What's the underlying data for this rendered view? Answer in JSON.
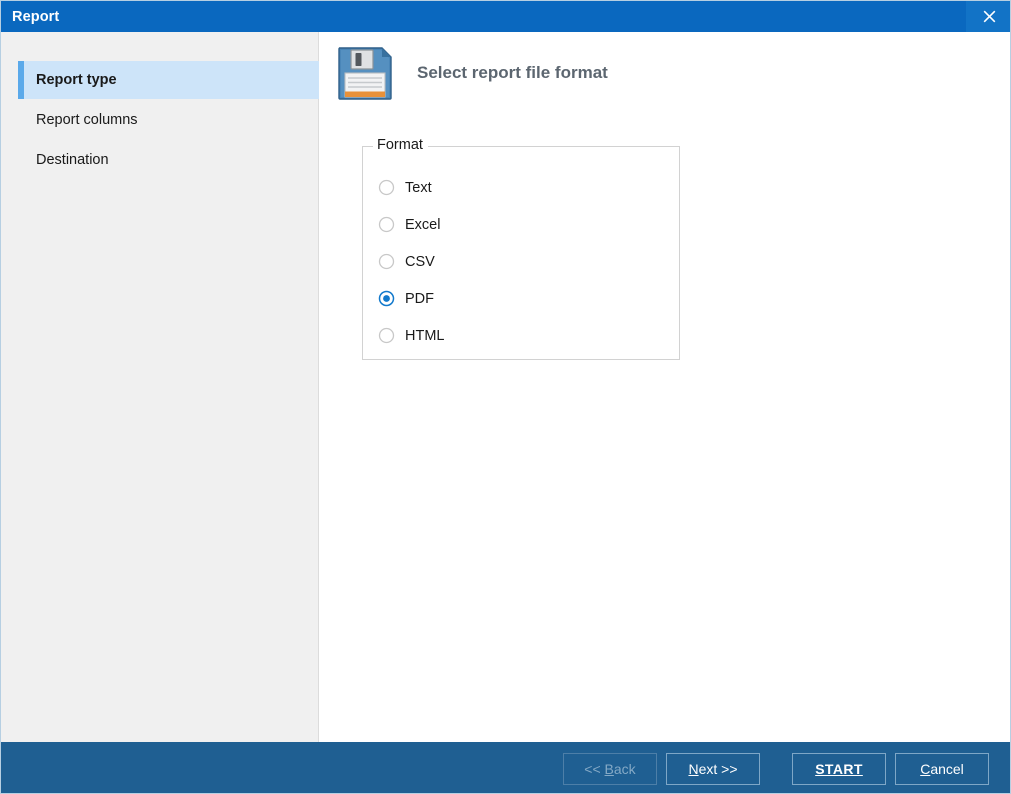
{
  "window": {
    "title": "Report",
    "close_icon": "close-icon"
  },
  "sidebar": {
    "items": [
      {
        "label": "Report type",
        "selected": true
      },
      {
        "label": "Report columns",
        "selected": false
      },
      {
        "label": "Destination",
        "selected": false
      }
    ]
  },
  "content": {
    "icon": "floppy-disk-save-icon",
    "heading": "Select report file format",
    "group": {
      "legend": "Format",
      "options": [
        {
          "label": "Text",
          "selected": false
        },
        {
          "label": "Excel",
          "selected": false
        },
        {
          "label": "CSV",
          "selected": false
        },
        {
          "label": "PDF",
          "selected": true
        },
        {
          "label": "HTML",
          "selected": false
        }
      ]
    }
  },
  "footer": {
    "buttons": [
      {
        "name": "back-button",
        "label": "<< Back",
        "mnemonic": "B",
        "state": "disabled",
        "style": "normal"
      },
      {
        "name": "next-button",
        "label": "Next >>",
        "mnemonic": "N",
        "state": "enabled",
        "style": "normal"
      },
      {
        "name": "start-button",
        "label": "START",
        "mnemonic": "S",
        "state": "enabled",
        "style": "primary"
      },
      {
        "name": "cancel-button",
        "label": "Cancel",
        "mnemonic": "C",
        "state": "enabled",
        "style": "normal"
      }
    ]
  },
  "colors": {
    "titlebar": "#0a68bf",
    "footer": "#1f5f92",
    "selection": "#cde4f9",
    "accent": "#5aa9ea",
    "radio_selected": "#1279cc",
    "sidebar": "#f0f0f0",
    "heading_text": "#5c6670"
  }
}
